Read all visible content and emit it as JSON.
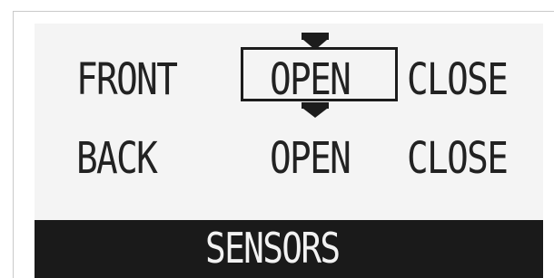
{
  "rows": [
    {
      "label": "FRONT",
      "option_a": "OPEN",
      "option_b": "CLOSE",
      "selected": "option_a"
    },
    {
      "label": "BACK",
      "option_a": "OPEN",
      "option_b": "CLOSE",
      "selected": null
    }
  ],
  "footer": {
    "title": "SENSORS"
  },
  "icons": {
    "cursor_up": "triangle-down-marker-icon",
    "cursor_down": "triangle-down-marker-icon"
  }
}
